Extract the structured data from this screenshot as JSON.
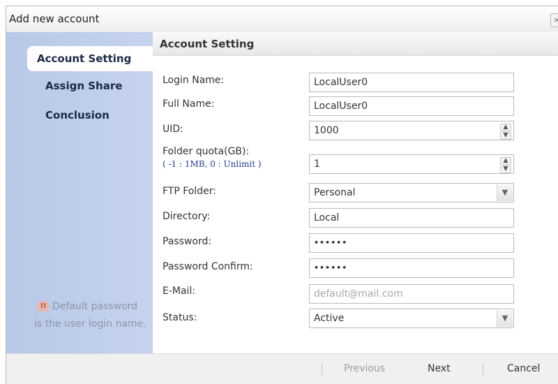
{
  "dialog": {
    "title": "Add new account",
    "close_label": "×"
  },
  "sidebar": {
    "items": [
      {
        "label": "Account Setting"
      },
      {
        "label": "Assign Share"
      },
      {
        "label": "Conclusion"
      }
    ],
    "hint": {
      "icon": "info-icon",
      "line1": "Default password",
      "line2": "is the user login name."
    }
  },
  "section": {
    "title": "Account Setting"
  },
  "form": {
    "login_name": {
      "label": "Login Name:",
      "value": "LocalUser0"
    },
    "full_name": {
      "label": "Full Name:",
      "value": "LocalUser0"
    },
    "uid": {
      "label": "UID:",
      "value": "1000"
    },
    "folder_quota": {
      "label": "Folder quota(GB):",
      "sublabel": "( -1 : 1MB, 0 : Unlimit )",
      "value": "1"
    },
    "ftp_folder": {
      "label": "FTP Folder:",
      "value": "Personal"
    },
    "directory": {
      "label": "Directory:",
      "value": "Local"
    },
    "password": {
      "label": "Password:",
      "value": "••••••"
    },
    "password_confirm": {
      "label": "Password Confirm:",
      "value": "••••••"
    },
    "email": {
      "label": "E-Mail:",
      "placeholder": "default@mail.com"
    },
    "status": {
      "label": "Status:",
      "value": "Active"
    }
  },
  "footer": {
    "previous": "Previous",
    "next": "Next",
    "cancel": "Cancel"
  },
  "colors": {
    "sidebar_bg": "#c5d3ee",
    "hint_text": "#8a94a6",
    "quota_hint": "#1f3a8a"
  }
}
